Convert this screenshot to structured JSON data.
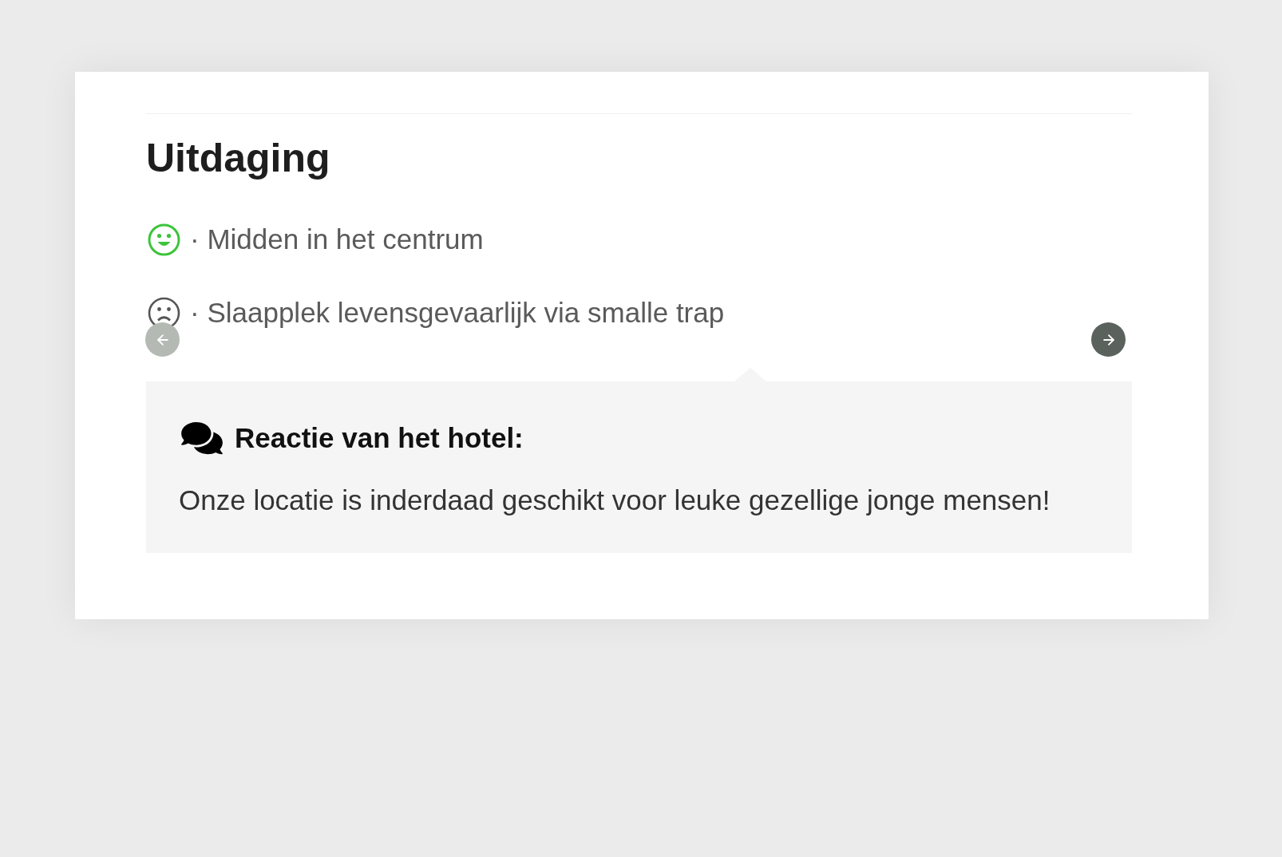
{
  "section": {
    "title": "Uitdaging"
  },
  "carousel": {
    "items": [
      {
        "kind": "positive",
        "text": "· Midden in het centrum"
      },
      {
        "kind": "negative",
        "text": "· Slaapplek levensgevaarlijk via smalle trap"
      }
    ],
    "prev_button": {
      "disabled": true
    },
    "next_button": {
      "disabled": false
    }
  },
  "hotel_response": {
    "heading": "Reactie van het hotel:",
    "text": "Onze locatie is inderdaad geschikt voor leuke gezellige jonge mensen!"
  }
}
